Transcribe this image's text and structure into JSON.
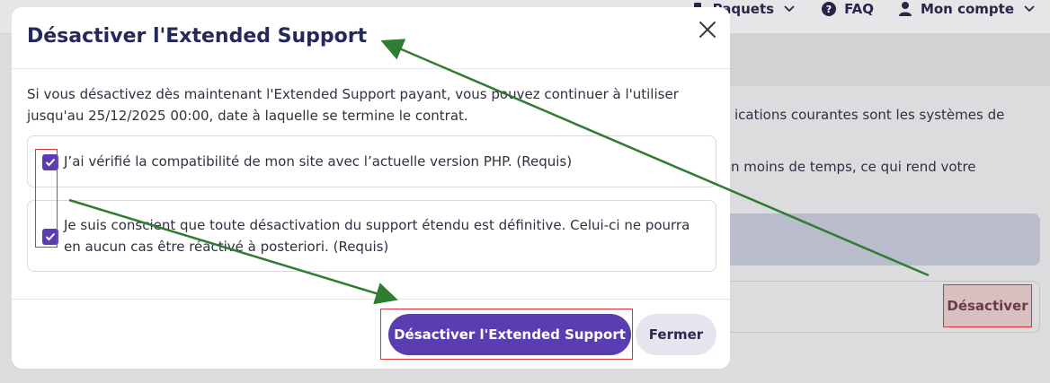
{
  "background": {
    "nav": {
      "packages_label": "Paquets",
      "faq_label": "FAQ",
      "account_label": "Mon compte"
    },
    "text_line_1": "ications courantes sont les systèmes de",
    "text_line_2": "n moins de temps, ce qui rend votre",
    "deactivate_label": "Désactiver"
  },
  "modal": {
    "title": "Désactiver l'Extended Support",
    "description": "Si vous désactivez dès maintenant l'Extended Support payant, vous pouvez continuer à l'utiliser jusqu'au 25/12/2025 00:00, date à laquelle se termine le contrat.",
    "checkboxes": [
      {
        "label": "J’ai vérifié la compatibilité de mon site avec l’actuelle version PHP. (Requis)",
        "checked": true
      },
      {
        "label": "Je suis conscient que toute désactivation du support étendu est définitive. Celui-ci ne pourra en aucun cas être réactivé à posteriori. (Requis)",
        "checked": true
      }
    ],
    "confirm_label": "Désactiver l'Extended Support",
    "close_label": "Fermer"
  },
  "colors": {
    "primary": "#5a3db0",
    "title": "#24285a",
    "annotation_arrow": "#2e7d32",
    "annotation_box": "#d8343a"
  }
}
